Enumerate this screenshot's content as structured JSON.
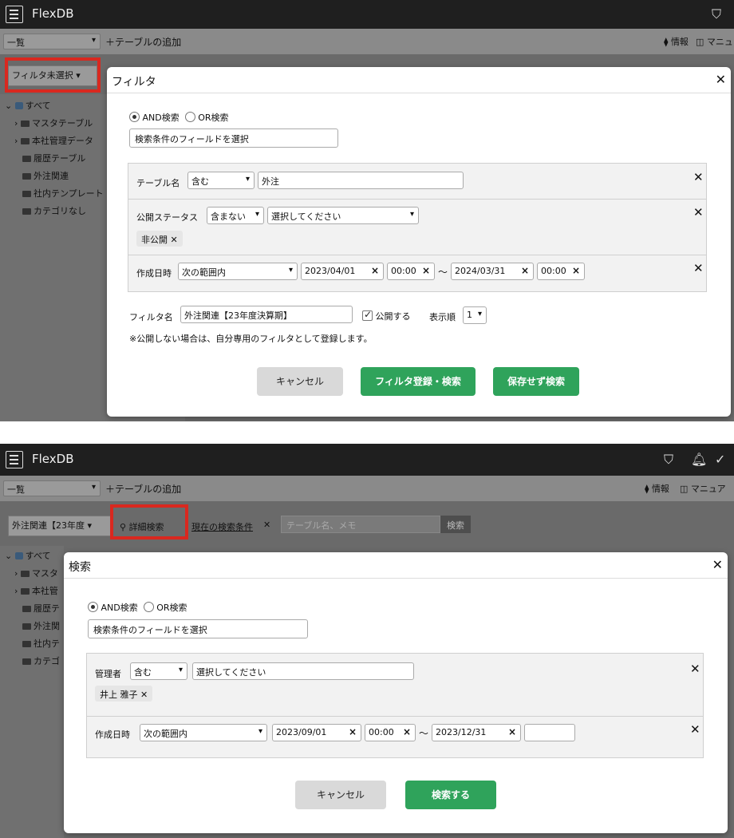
{
  "app": {
    "title": "FlexDB",
    "view_select": "一覧",
    "add_table": "＋テーブルの追加",
    "info": "情報",
    "manual_1": "マニュ",
    "manual_2": "マニュア"
  },
  "sidebar": {
    "items": [
      "すべて",
      "マスタテーブル",
      "本社管理データ",
      "履歴テーブル",
      "外注関連",
      "社内テンプレート",
      "カテゴリなし"
    ],
    "items_cut": [
      "すべて",
      "マスタ",
      "本社管",
      "履歴テ",
      "外注関",
      "社内テ",
      "カテゴ"
    ]
  },
  "panel1": {
    "filter_select": "フィルタ未選択",
    "modal": {
      "title": "フィルタ",
      "close": "✕",
      "radio_and": "AND検索",
      "radio_or": "OR検索",
      "field_select": "検索条件のフィールドを選択",
      "conditions": {
        "c1": {
          "label": "テーブル名",
          "op": "含む",
          "value": "外注"
        },
        "c2": {
          "label": "公開ステータス",
          "op": "含まない",
          "value": "選択してください",
          "tag": "非公開 ✕"
        },
        "c3": {
          "label": "作成日時",
          "op": "次の範囲内",
          "date_from": "2023/04/01",
          "time_from": "00:00",
          "tilde": "〜",
          "date_to": "2024/03/31",
          "time_to": "00:00"
        }
      },
      "filter_name_label": "フィルタ名",
      "filter_name_value": "外注関連【23年度決算期】",
      "publish_label": "公開する",
      "order_label": "表示順",
      "order_value": "1",
      "note": "※公開しない場合は、自分専用のフィルタとして登録します。",
      "btn_cancel": "キャンセル",
      "btn_register": "フィルタ登録・検索",
      "btn_search_nosave": "保存せず検索"
    }
  },
  "panel2": {
    "filter_select": "外注関連【23年度",
    "detail_search": "詳細検索",
    "current_conditions": "現在の検索条件",
    "current_conditions_x": "✕",
    "search_placeholder": "テーブル名、メモ",
    "search_button": "検索",
    "modal": {
      "title": "検索",
      "close": "✕",
      "radio_and": "AND検索",
      "radio_or": "OR検索",
      "field_select": "検索条件のフィールドを選択",
      "conditions": {
        "c1": {
          "label": "管理者",
          "op": "含む",
          "value": "選択してください",
          "tag": "井上 雅子 ✕"
        },
        "c2": {
          "label": "作成日時",
          "op": "次の範囲内",
          "date_from": "2023/09/01",
          "time_from": "00:00",
          "tilde": "〜",
          "date_to": "2023/12/31",
          "time_to": ""
        }
      },
      "btn_cancel": "キャンセル",
      "btn_search": "検索する"
    }
  },
  "colors": {
    "highlight_red": "#d9281f",
    "green_button": "#2fa35b",
    "header": "#1f1f1f"
  }
}
